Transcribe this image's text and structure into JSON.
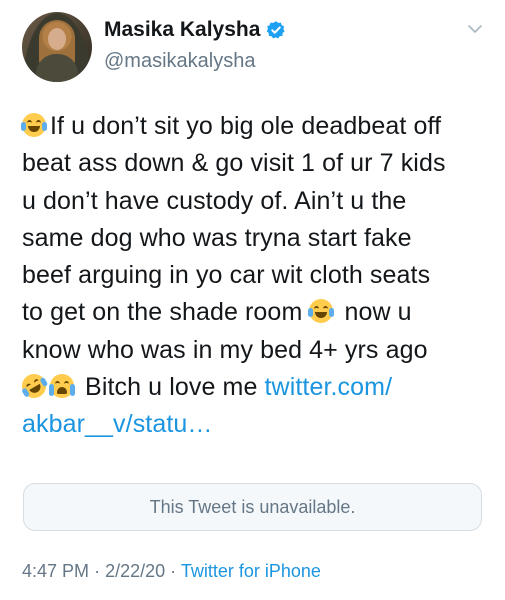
{
  "user": {
    "name": "Masika Kalysha",
    "handle": "@masikakalysha"
  },
  "tweet": {
    "lines": [
      "If u don’t sit yo big ole deadbeat off",
      "beat ass down & go visit 1 of ur 7 kids",
      "u don’t have custody of. Ain’t u the",
      "same dog who was tryna start fake",
      "beef arguing in yo car wit cloth seats",
      "to get on the shade room",
      "now u",
      "know who was in my bed 4+ yrs ago",
      "Bitch u love me",
      "twitter.com/",
      "akbar__v/statu…"
    ]
  },
  "quoted_tweet": {
    "text": "This Tweet is unavailable."
  },
  "meta": {
    "time": "4:47 PM",
    "sep1": "·",
    "date": "2/22/20",
    "sep2": "·",
    "source": "Twitter for iPhone"
  },
  "colors": {
    "link": "#1b95e0",
    "verified": "#1da1f2",
    "secondary_text": "#657786"
  },
  "icons": [
    "verified-badge-icon",
    "chevron-down-icon",
    "joy-emoji-icon",
    "rofl-emoji-icon",
    "sob-emoji-icon"
  ]
}
